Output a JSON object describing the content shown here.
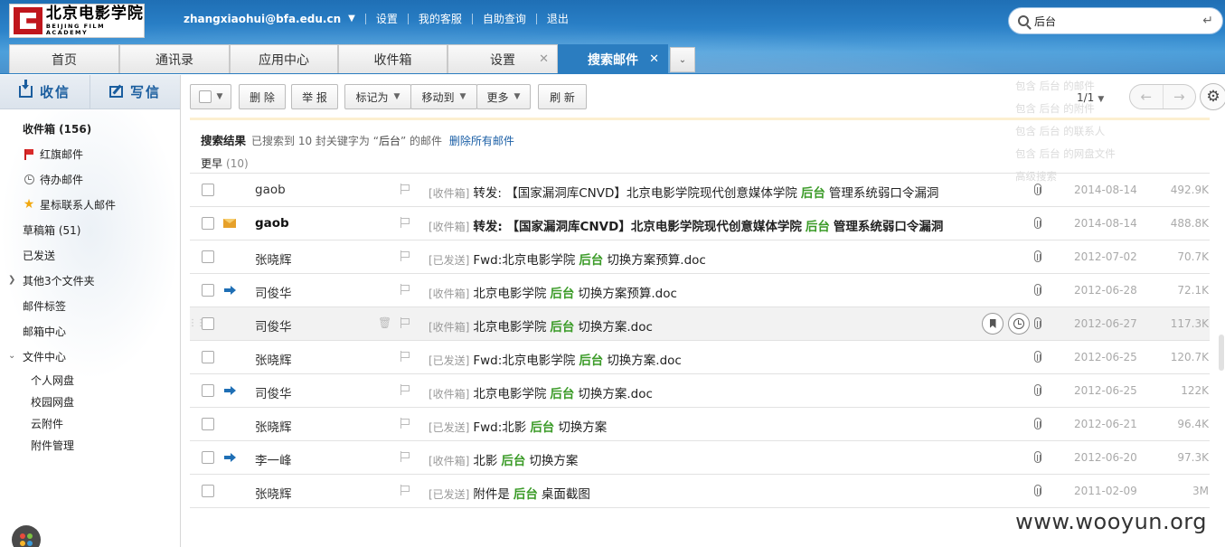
{
  "header": {
    "logo": {
      "cn": "北京电影学院",
      "en": "BEIJING FILM ACADEMY"
    },
    "user": "zhangxiaohui@bfa.edu.cn",
    "links": [
      "设置",
      "我的客服",
      "自助查询",
      "退出"
    ],
    "search": {
      "value": "后台",
      "placeholder": ""
    }
  },
  "tabs": [
    {
      "label": "首页",
      "closable": false,
      "active": false
    },
    {
      "label": "通讯录",
      "closable": false,
      "active": false
    },
    {
      "label": "应用中心",
      "closable": false,
      "active": false
    },
    {
      "label": "收件箱",
      "closable": false,
      "active": false
    },
    {
      "label": "设置",
      "closable": true,
      "active": false
    },
    {
      "label": "搜索邮件",
      "closable": true,
      "active": true
    }
  ],
  "sidebar": {
    "compose": {
      "receive": "收信",
      "write": "写信"
    },
    "folders": {
      "inbox": "收件箱 (156)",
      "flagged": "红旗邮件",
      "todo": "待办邮件",
      "starred": "星标联系人邮件",
      "drafts": "草稿箱 (51)",
      "sent": "已发送",
      "other": "其他3个文件夹",
      "tags": "邮件标签",
      "center": "邮箱中心",
      "files": "文件中心"
    },
    "file_items": [
      "个人网盘",
      "校园网盘",
      "云附件",
      "附件管理"
    ]
  },
  "toolbar": {
    "delete": "删 除",
    "report": "举 报",
    "mark": "标记为",
    "move": "移动到",
    "more": "更多",
    "refresh": "刷 新",
    "page": "1/1"
  },
  "suggestions": [
    "包含 后台 的邮件",
    "包含 后台 的附件",
    "包含 后台 的联系人",
    "包含 后台 的网盘文件",
    "高级搜索"
  ],
  "results": {
    "title": "搜索结果",
    "summary": "已搜索到 10 封关键字为 “",
    "keyword": "后台",
    "summary_end": "” 的邮件",
    "delete_all": "删除所有邮件",
    "group": "更早",
    "group_count": "(10)"
  },
  "emails": [
    {
      "from": "gaob",
      "icon": "",
      "folder": "[收件箱]",
      "pre": "转发: 【国家漏洞库CNVD】北京电影学院现代创意媒体学院",
      "kw": "后台",
      "post": "管理系统弱口令漏洞",
      "date": "2014-08-14",
      "size": "492.9K",
      "unread": false,
      "hover": false
    },
    {
      "from": "gaob",
      "icon": "envelope",
      "folder": "[收件箱]",
      "pre": "转发: 【国家漏洞库CNVD】北京电影学院现代创意媒体学院",
      "kw": "后台",
      "post": "管理系统弱口令漏洞",
      "date": "2014-08-14",
      "size": "488.8K",
      "unread": true,
      "hover": false
    },
    {
      "from": "张晓辉",
      "icon": "",
      "folder": "[已发送]",
      "pre": "Fwd:北京电影学院",
      "kw": "后台",
      "post": "切换方案预算.doc",
      "date": "2012-07-02",
      "size": "70.7K",
      "unread": false,
      "hover": false
    },
    {
      "from": "司俊华",
      "icon": "forward",
      "folder": "[收件箱]",
      "pre": "北京电影学院",
      "kw": "后台",
      "post": "切换方案预算.doc",
      "date": "2012-06-28",
      "size": "72.1K",
      "unread": false,
      "hover": false
    },
    {
      "from": "司俊华",
      "icon": "",
      "folder": "[收件箱]",
      "pre": "北京电影学院",
      "kw": "后台",
      "post": "切换方案.doc",
      "date": "2012-06-27",
      "size": "117.3K",
      "unread": false,
      "hover": true
    },
    {
      "from": "张晓辉",
      "icon": "",
      "folder": "[已发送]",
      "pre": "Fwd:北京电影学院",
      "kw": "后台",
      "post": "切换方案.doc",
      "date": "2012-06-25",
      "size": "120.7K",
      "unread": false,
      "hover": false
    },
    {
      "from": "司俊华",
      "icon": "forward",
      "folder": "[收件箱]",
      "pre": "北京电影学院",
      "kw": "后台",
      "post": "切换方案.doc",
      "date": "2012-06-25",
      "size": "122K",
      "unread": false,
      "hover": false
    },
    {
      "from": "张晓辉",
      "icon": "",
      "folder": "[已发送]",
      "pre": "Fwd:北影",
      "kw": "后台",
      "post": "切换方案",
      "date": "2012-06-21",
      "size": "96.4K",
      "unread": false,
      "hover": false
    },
    {
      "from": "李一峰",
      "icon": "forward",
      "folder": "[收件箱]",
      "pre": "北影",
      "kw": "后台",
      "post": "切换方案",
      "date": "2012-06-20",
      "size": "97.3K",
      "unread": false,
      "hover": false
    },
    {
      "from": "张晓辉",
      "icon": "",
      "folder": "[已发送]",
      "pre": "附件是",
      "kw": "后台",
      "post": "桌面截图",
      "date": "2011-02-09",
      "size": "3M",
      "unread": false,
      "hover": false
    }
  ],
  "watermark": "www.wooyun.org",
  "colors": {
    "brand_blue": "#2b7dc0",
    "keyword_green": "#3b9b28",
    "link_blue": "#1b5fa6",
    "flag_red": "#d92a2a",
    "star": "#f1a80f"
  }
}
